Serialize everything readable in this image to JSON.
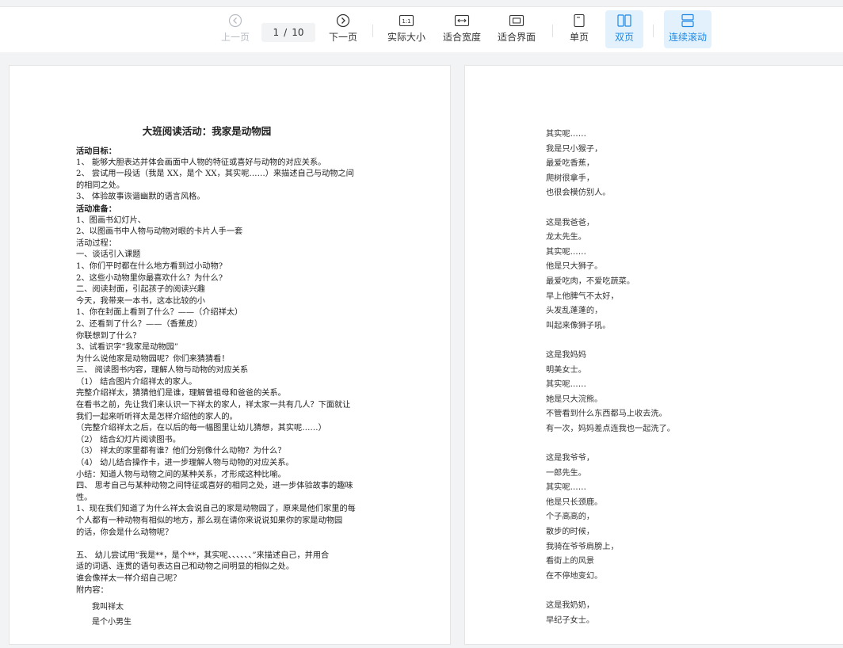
{
  "toolbar": {
    "prev_label": "上一页",
    "next_label": "下一页",
    "current_page": "1",
    "page_sep": "/",
    "total_pages": "10",
    "actual_size_label": "实际大小",
    "fit_width_label": "适合宽度",
    "fit_page_label": "适合界面",
    "single_page_label": "单页",
    "double_page_label": "双页",
    "continuous_label": "连续滚动",
    "actual_size_icon_text": "1:1",
    "accent_color": "#1e88e5",
    "active_bg": "#e3f1fd"
  },
  "left_page": {
    "title": "大班阅读活动：我家是动物园",
    "lines": [
      {
        "t": "活动目标：",
        "bold": true
      },
      {
        "t": "1、     能够大胆表达并体会画面中人物的特征或喜好与动物的对应关系。"
      },
      {
        "t": "2、     尝试用一段话（我是 XX，是个 XX，其实呢……）来描述自己与动物之间"
      },
      {
        "t": "的相同之处。"
      },
      {
        "t": "3、     体验故事诙谐幽默的语言风格。"
      },
      {
        "t": "活动准备：",
        "bold": true
      },
      {
        "t": "1、图画书幻灯片、"
      },
      {
        "t": "2、以图画书中人物与动物对眼的卡片人手一套"
      },
      {
        "t": "活动过程："
      },
      {
        "t": "一、谈话引入课题"
      },
      {
        "t": " 1、你们平时都在什么地方看到过小动物?"
      },
      {
        "t": " 2、这些小动物里你最喜欢什么？为什么?"
      },
      {
        "t": "二、阅读封面，引起孩子的阅读兴趣"
      },
      {
        "t": "  今天，我带来一本书，这本比较的小"
      },
      {
        "t": "  1、你在封面上看到了什么？——（介绍祥太）"
      },
      {
        "t": "  2、还看到了什么？——（香蕉皮）"
      },
      {
        "t": "     你联想到了什么？"
      },
      {
        "t": "  3、试看识字“我家是动物园”"
      },
      {
        "t": "     为什么说他家是动物园呢？你们来猜猜看！"
      },
      {
        "t": "三、     阅读图书内容，理解人物与动物的对应关系"
      },
      {
        "t": "（1）     结合图片介绍祥太的家人。"
      },
      {
        "t": "        完整介绍祥太，猜猜他们是谁，理解曾祖母和爸爸的关系。"
      },
      {
        "t": "在看书之前，先让我们来认识一下祥太的家人，祥太家一共有几人？下面就让"
      },
      {
        "t": "我们一起来听听祥太是怎样介绍他的家人的。"
      },
      {
        "t": "      （完整介绍祥太之后，在以后的每一幅图里让幼儿猜想，其实呢……）"
      },
      {
        "t": "（2）     结合幻灯片阅读图书。"
      },
      {
        "t": "（3）     祥太的家里都有谁？他们分别像什么动物？为什么？"
      },
      {
        "t": "（4）     幼儿结合操作卡，进一步理解人物与动物的对应关系。"
      },
      {
        "t": "小结：知道人物与动物之间的某种关系，才形成这种比喻。"
      },
      {
        "t": "四、  思考自己与某种动物之间特征或喜好的相同之处，进一步体验故事的趣味"
      },
      {
        "t": "性。"
      },
      {
        "t": "1、现在我们知道了为什么祥太会说自己的家是动物园了，原来是他们家里的每"
      },
      {
        "t": "个人都有一种动物有相似的地方，那么现在请你来说说如果你的家是动物园"
      },
      {
        "t": "的话，你会是什么动物呢？"
      },
      {
        "t": "",
        "gap": true
      },
      {
        "t": "五、  幼儿尝试用“我是**，是个**，其实呢、、、、、、”来描述自己，并用合"
      },
      {
        "t": "适的词语、连贯的语句表达自己和动物之间明显的相似之处。"
      },
      {
        "t": "谁会像祥太一样介绍自己呢？"
      },
      {
        "t": "附内容："
      }
    ],
    "poem": [
      "我叫祥太",
      "是个小男生"
    ]
  },
  "right_page": {
    "lines": [
      "其实呢……",
      "我是只小猴子，",
      "最爱吃香蕉，",
      "爬树很拿手，",
      "也很会模仿别人。",
      "",
      "这是我爸爸，",
      "龙太先生。",
      "其实呢……",
      "他是只大狮子。",
      "最爱吃肉，不爱吃蔬菜。",
      "早上他脾气不太好，",
      "头发乱蓬蓬的，",
      "叫起来像狮子吼。",
      "",
      "这是我妈妈",
      "明美女士。",
      "其实呢……",
      "她是只大浣熊。",
      "不管看到什么东西都马上收去洗。",
      "有一次，妈妈差点连我也一起洗了。",
      "",
      "这是我爷爷，",
      "一郎先生。",
      "其实呢……",
      "他是只长颈鹿。",
      "个子高高的，",
      "散步的时候，",
      "我骑在爷爷肩膀上，",
      "看街上的风景",
      "在不停地变幻。",
      "",
      "这是我奶奶，",
      "早纪子女士。"
    ]
  }
}
